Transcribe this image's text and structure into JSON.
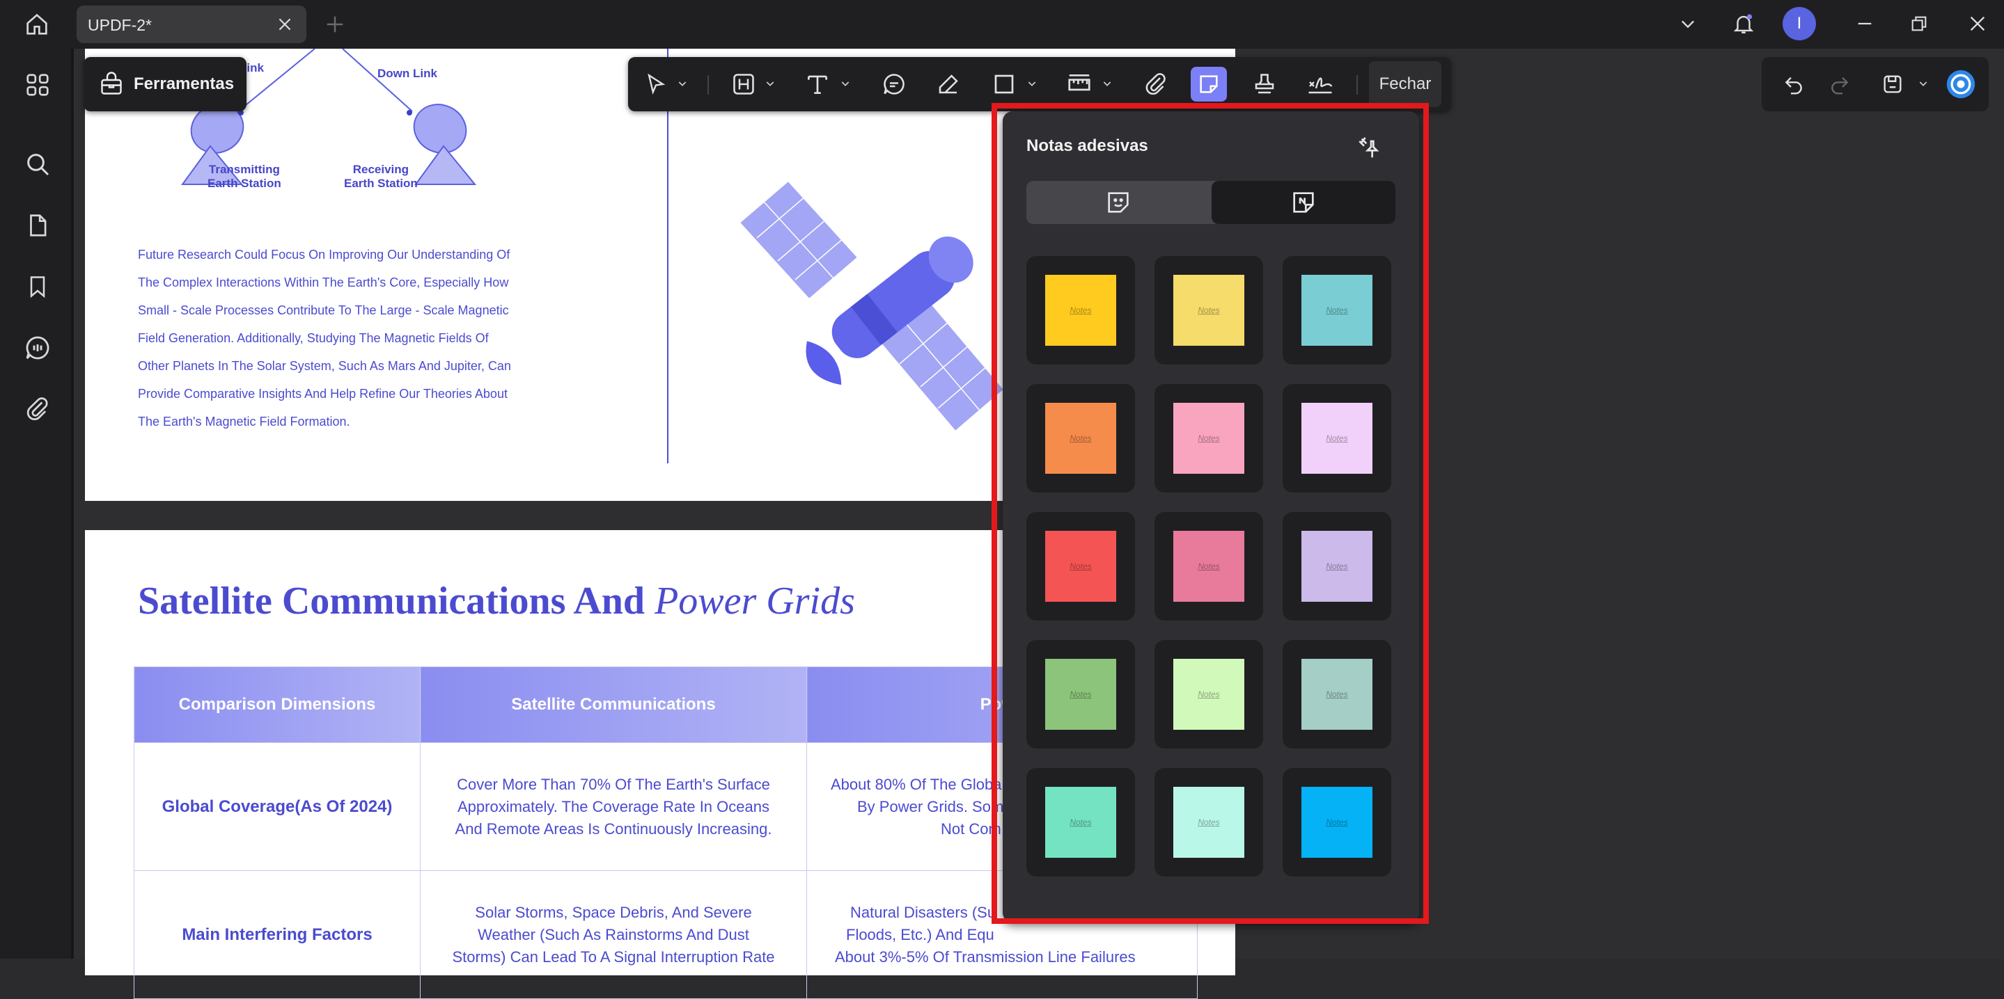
{
  "tab": {
    "title": "UPDF-2*"
  },
  "tools_chip": {
    "label": "Ferramentas"
  },
  "toolbar": {
    "close_label": "Fechar"
  },
  "user": {
    "initial": "I"
  },
  "page1": {
    "diagram": {
      "uplink_label": "Link",
      "downlink_label": "Down Link",
      "tx_station": "Transmitting\nEarth Station",
      "rx_station": "Receiving\nEarth Station"
    },
    "paragraph_lines": [
      "Future Research Could Focus On Improving Our Understanding Of",
      "The Complex Interactions Within The Earth's Core, Especially How",
      "Small - Scale Processes Contribute To The Large - Scale Magnetic",
      "Field Generation. Additionally, Studying The Magnetic Fields Of",
      "Other Planets In The Solar System, Such As Mars And Jupiter, Can",
      "Provide Comparative Insights And Help Refine Our Theories About",
      "The Earth's Magnetic Field Formation."
    ]
  },
  "page2": {
    "title_main": "Satellite Communications And",
    "title_italic": "Power Grids",
    "table": {
      "headers": [
        "Comparison Dimensions",
        "Satellite Communications",
        "Powe"
      ],
      "rows": [
        {
          "head": "Global Coverage(As Of 2024)",
          "col1": [
            "Cover More Than 70% Of The Earth's Surface",
            "Approximately. The Coverage Rate In Oceans",
            "And Remote Areas Is Continuously Increasing."
          ],
          "col2": [
            "About 80% Of The Globa",
            "By Power Grids. Some F",
            "Not Com"
          ]
        },
        {
          "head": "Main Interfering Factors",
          "col1": [
            "Solar Storms, Space Debris, And Severe",
            "Weather (Such As Rainstorms And Dust",
            "Storms) Can Lead To A Signal Interruption Rate"
          ],
          "col2": [
            "Natural Disasters (Su",
            "Floods, Etc.) And Equ",
            "About 3%-5% Of Transmission Line Failures"
          ]
        }
      ]
    }
  },
  "sticky_panel": {
    "title": "Notas adesivas",
    "note_word": "Notes",
    "colors": [
      "#FFCB1F",
      "#F5DC6B",
      "#79CDD3",
      "#F58C4B",
      "#F9A5C0",
      "#F1D0F9",
      "#F55454",
      "#E87B9C",
      "#CBBAEA",
      "#8DC47B",
      "#D1F9BA",
      "#A4CEC6",
      "#74E3C2",
      "#B9F7E9",
      "#05B2F5"
    ]
  },
  "accent": "#7C80F6",
  "highlight_color": "#E3191B"
}
